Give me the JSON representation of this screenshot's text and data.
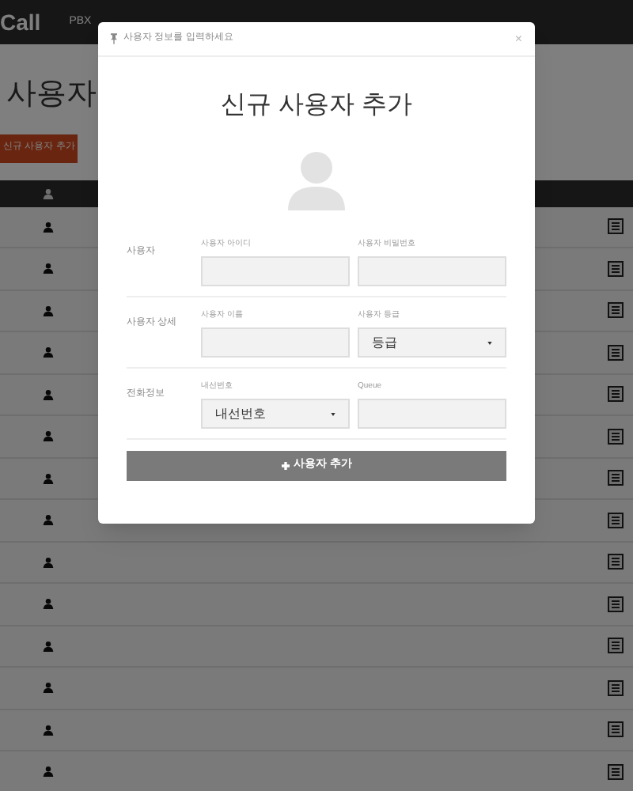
{
  "nav": {
    "brand": "Call",
    "items": [
      {
        "label": "PBX"
      }
    ]
  },
  "page": {
    "title": "사용자",
    "add_button": "신규 사용자 추가"
  },
  "modal": {
    "header": "사용자 정보를 입력하세요",
    "close": "×",
    "title": "신규 사용자 추가",
    "sections": [
      {
        "label": "사용자",
        "fields": [
          {
            "kind": "input",
            "label": "사용자 아이디"
          },
          {
            "kind": "input",
            "label": "사용자 비밀번호"
          }
        ]
      },
      {
        "label": "사용자 상세",
        "fields": [
          {
            "kind": "input",
            "label": "사용자 이름"
          },
          {
            "kind": "select",
            "label": "사용자 등급",
            "value": "등급"
          }
        ]
      },
      {
        "label": "전화정보",
        "fields": [
          {
            "kind": "select",
            "label": "내선번호",
            "value": "내선번호"
          },
          {
            "kind": "input",
            "label": "Queue"
          }
        ]
      }
    ],
    "submit": "사용자 추가"
  }
}
